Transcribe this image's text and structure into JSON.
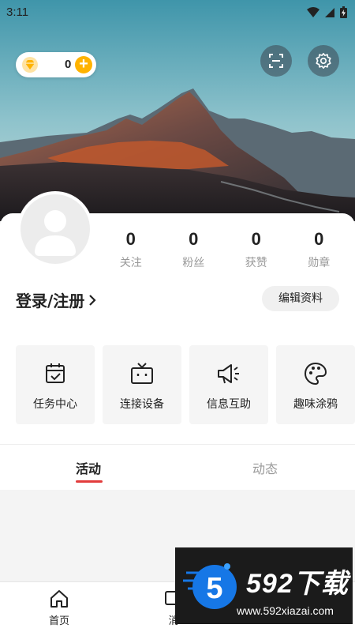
{
  "status_bar": {
    "time": "3:11"
  },
  "wallet": {
    "coins": "0",
    "add_symbol": "+"
  },
  "profile": {
    "stats": [
      {
        "value": "0",
        "label": "关注"
      },
      {
        "value": "0",
        "label": "粉丝"
      },
      {
        "value": "0",
        "label": "获赞"
      },
      {
        "value": "0",
        "label": "勋章"
      }
    ],
    "login_label": "登录/注册",
    "login_chevron": "›",
    "edit_label": "编辑资料"
  },
  "shortcuts": [
    {
      "label": "任务中心",
      "icon": "calendar-check-icon"
    },
    {
      "label": "连接设备",
      "icon": "tv-icon"
    },
    {
      "label": "信息互助",
      "icon": "megaphone-icon"
    },
    {
      "label": "趣味涂鸦",
      "icon": "palette-icon"
    }
  ],
  "tabs": [
    {
      "label": "活动",
      "active": true
    },
    {
      "label": "动态",
      "active": false
    }
  ],
  "bottom_nav": [
    {
      "label": "首页",
      "icon": "home-icon"
    },
    {
      "label": "消",
      "icon": "message-icon"
    }
  ],
  "watermark": {
    "title": "592下载",
    "url": "www.592xiazai.com"
  },
  "colors": {
    "accent_red": "#e23c3c",
    "coin_orange": "#ffb300"
  }
}
